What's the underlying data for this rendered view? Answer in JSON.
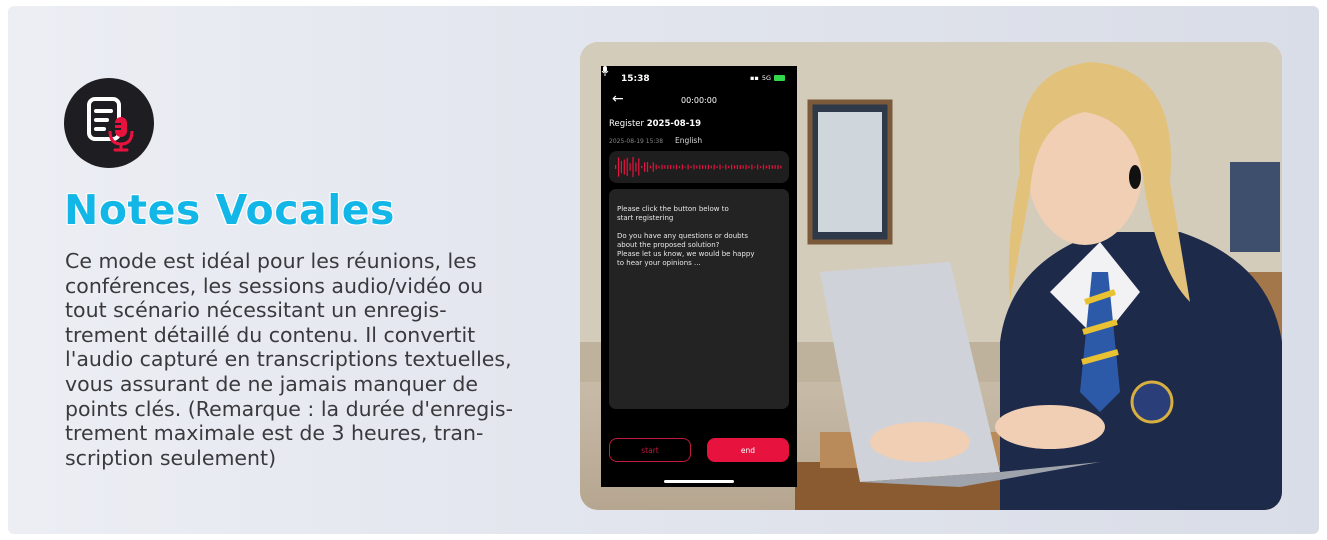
{
  "feature": {
    "icon": "transcript-mic-icon",
    "title": "Notes Vocales",
    "description_lines": [
      "Ce mode est idéal pour les réunions, les",
      "conférences, les sessions audio/vidéo ou",
      "tout scénario nécessitant un enregis-",
      "trement détaillé du contenu. Il convertit",
      "l'audio capturé en transcriptions textuelles,",
      "vous assurant de ne jamais manquer de",
      "points clés. (Remarque : la durée d'enregis-",
      "trement maximale est de 3 heures, tran-",
      "scription seulement)"
    ]
  },
  "phone": {
    "status": {
      "time": "15:38",
      "network": "5G"
    },
    "timer": "00:00:00",
    "register_label": "Register",
    "register_date": "2025-08-19",
    "meta_datetime": "2025-08-19 15:38",
    "meta_language": "English",
    "text_lines": [
      "Please click the button below to",
      "start registering",
      "Do you have any questions or doubts",
      "about the proposed solution?",
      "Please let us know, we would be happy",
      "to hear your opinions ..."
    ],
    "start_label": "start",
    "end_label": "end"
  },
  "colors": {
    "accent_red": "#e8123f",
    "title_blue": "#12b7e8",
    "icon_bg": "#1e1e22"
  }
}
